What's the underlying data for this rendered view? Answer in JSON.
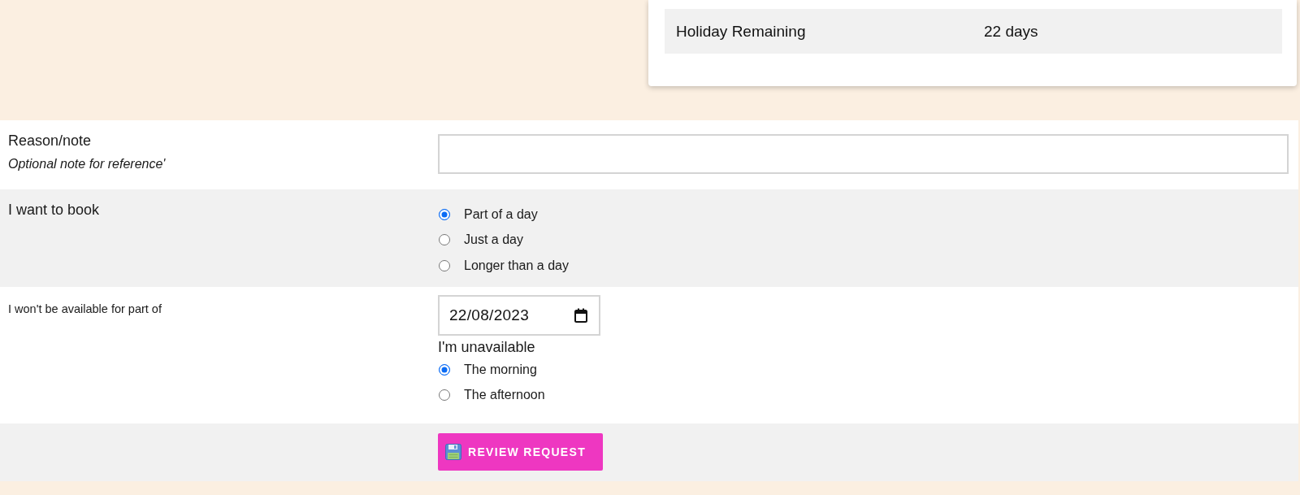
{
  "summary_card": {
    "rows": [
      {
        "label": "Holiday Remaining",
        "value": "22 days"
      }
    ]
  },
  "form": {
    "rows": [
      {
        "kind": "note",
        "label": "Reason/note",
        "help": "Optional note for reference'"
      },
      {
        "kind": "choice",
        "label": "I want to book",
        "options": [
          {
            "label": "Part of a day",
            "selected": true
          },
          {
            "label": "Just a day",
            "selected": false
          },
          {
            "label": "Longer than a day",
            "selected": false
          }
        ]
      },
      {
        "kind": "date",
        "label": "I won't be available for part of",
        "date_field": {
          "value": "22/08/2023"
        },
        "sublabel": "I'm unavailable",
        "options": [
          {
            "label": "The morning",
            "selected": true
          },
          {
            "label": "The afternoon",
            "selected": false
          }
        ]
      },
      {
        "kind": "actions",
        "button": {
          "label": "REVIEW REQUEST"
        }
      }
    ]
  }
}
